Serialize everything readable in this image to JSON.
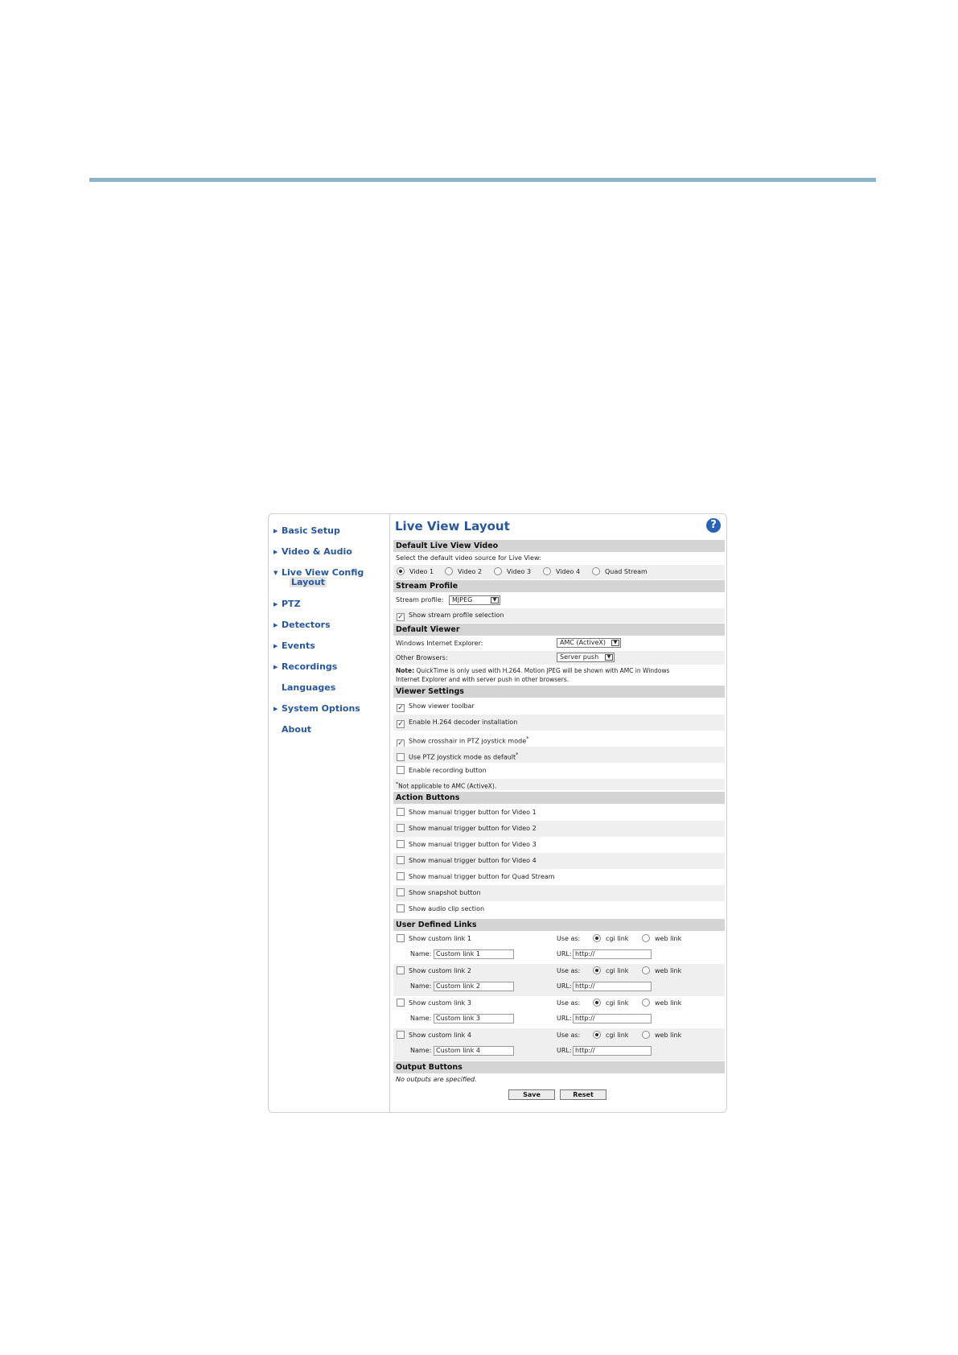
{
  "sidebar": {
    "items": [
      {
        "label": "Basic Setup",
        "expanded": false
      },
      {
        "label": "Video & Audio",
        "expanded": false
      },
      {
        "label": "Live View Config",
        "expanded": true,
        "sub": "Layout"
      },
      {
        "label": "PTZ",
        "expanded": false
      },
      {
        "label": "Detectors",
        "expanded": false
      },
      {
        "label": "Events",
        "expanded": false
      },
      {
        "label": "Recordings",
        "expanded": false
      },
      {
        "label": "Languages"
      },
      {
        "label": "System Options",
        "expanded": false
      },
      {
        "label": "About"
      }
    ]
  },
  "main": {
    "title": "Live View Layout",
    "help_icon": "?",
    "default_video": {
      "heading": "Default Live View Video",
      "instruction": "Select the default video source for Live View:",
      "options": [
        "Video 1",
        "Video 2",
        "Video 3",
        "Video 4",
        "Quad Stream"
      ],
      "selected": "Video 1"
    },
    "stream_profile": {
      "heading": "Stream Profile",
      "label": "Stream profile:",
      "value": "MJPEG",
      "show_selection_label": "Show stream profile selection",
      "show_selection_checked": true
    },
    "default_viewer": {
      "heading": "Default Viewer",
      "ie_label": "Windows Internet Explorer:",
      "ie_value": "AMC (ActiveX)",
      "other_label": "Other Browsers:",
      "other_value": "Server push",
      "note_bold": "Note:",
      "note_line1": " QuickTime is only used with H.264. Motion JPEG will be shown with AMC in Windows",
      "note_line2": "Internet Explorer and with server push in other browsers."
    },
    "viewer_settings": {
      "heading": "Viewer Settings",
      "items": [
        {
          "label": "Show viewer toolbar",
          "checked": true,
          "star": ""
        },
        {
          "label": "Enable H.264 decoder installation",
          "checked": true,
          "star": ""
        },
        {
          "label": "Show crosshair in PTZ joystick mode",
          "checked": true,
          "star": "*"
        },
        {
          "label": "Use PTZ joystick mode as default",
          "checked": false,
          "star": "*"
        },
        {
          "label": "Enable recording button",
          "checked": false,
          "star": ""
        }
      ],
      "footnote_star": "*",
      "footnote": "Not applicable to AMC (ActiveX)."
    },
    "action_buttons": {
      "heading": "Action Buttons",
      "items": [
        "Show manual trigger button for Video 1",
        "Show manual trigger button for Video 2",
        "Show manual trigger button for Video 3",
        "Show manual trigger button for Video 4",
        "Show manual trigger button for Quad Stream",
        "Show snapshot button",
        "Show audio clip section"
      ]
    },
    "user_links": {
      "heading": "User Defined Links",
      "use_as_label": "Use as:",
      "cgi_label": "cgi link",
      "web_label": "web link",
      "name_label": "Name:",
      "url_label": "URL:",
      "links": [
        {
          "label": "Show custom link 1",
          "name": "Custom link 1",
          "url": "http://"
        },
        {
          "label": "Show custom link 2",
          "name": "Custom link 2",
          "url": "http://"
        },
        {
          "label": "Show custom link 3",
          "name": "Custom link 3",
          "url": "http://"
        },
        {
          "label": "Show custom link 4",
          "name": "Custom link 4",
          "url": "http://"
        }
      ]
    },
    "output_buttons": {
      "heading": "Output Buttons",
      "note": "No outputs are specified."
    },
    "save_label": "Save",
    "reset_label": "Reset"
  },
  "colors": {
    "accent": "#28579a",
    "section_bg": "#d4d4d4",
    "rule": "#8db3c7"
  }
}
